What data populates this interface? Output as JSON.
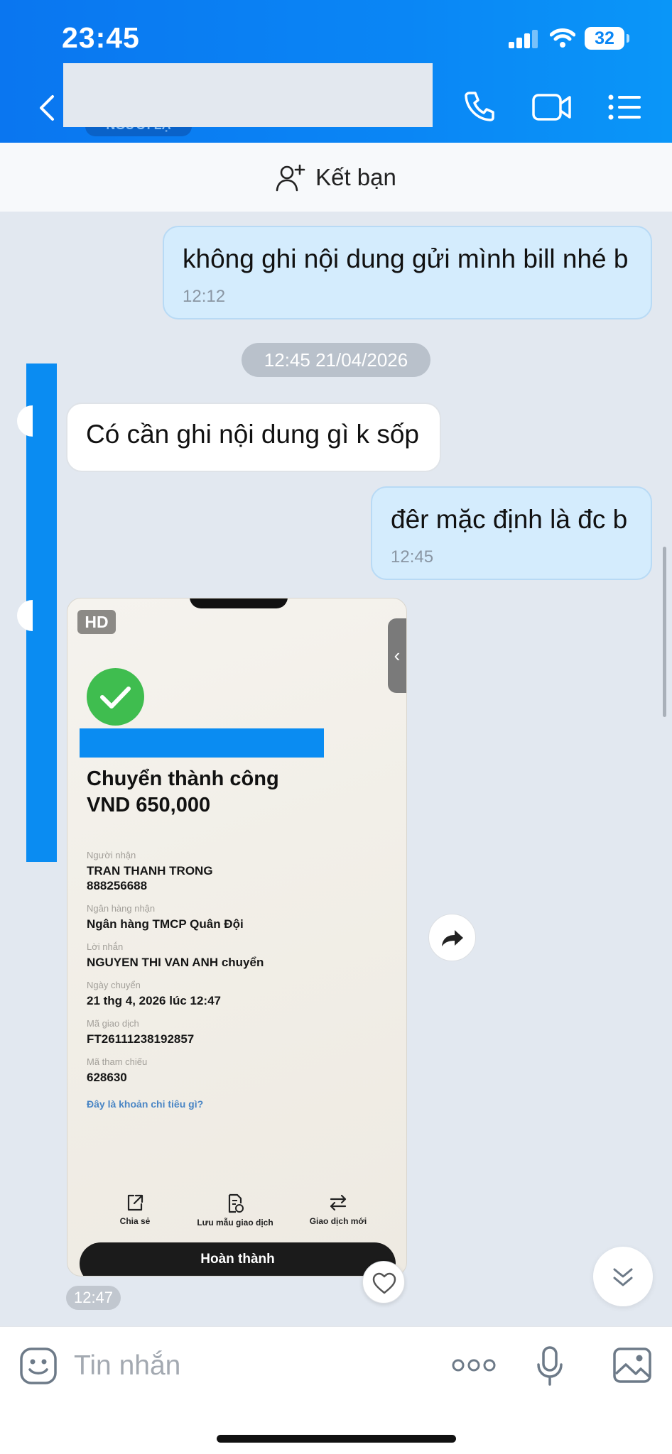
{
  "status_bar": {
    "time": "23:45",
    "battery": "32"
  },
  "header": {
    "name_tag": "NGƯỜI LẠ"
  },
  "friend_bar": {
    "label": "Kết bạn"
  },
  "messages": [
    {
      "side": "me",
      "text": "không ghi nội dung gửi mình bill nhé b",
      "time": "12:12"
    },
    {
      "side": "them",
      "text": "Có cần ghi nội dung gì k sốp"
    },
    {
      "side": "me",
      "text": "đêr mặc định là đc b",
      "time": "12:45"
    }
  ],
  "date_separator": "12:45 21/04/2026",
  "image_message": {
    "hd_label": "HD",
    "time": "12:47",
    "receipt": {
      "title_line1": "Chuyển thành công",
      "title_line2": "VND 650,000",
      "fields": [
        {
          "key": "Người nhận",
          "value": "TRAN THANH TRONG",
          "value2": "888256688"
        },
        {
          "key": "Ngân hàng nhận",
          "value": "Ngân hàng TMCP Quân Đội"
        },
        {
          "key": "Lời nhắn",
          "value": "NGUYEN THI VAN ANH chuyển"
        },
        {
          "key": "Ngày chuyển",
          "value": "21 thg 4, 2026 lúc 12:47"
        },
        {
          "key": "Mã giao dịch",
          "value": "FT26111238192857"
        },
        {
          "key": "Mã tham chiếu",
          "value": "628630"
        }
      ],
      "link": "Đây là khoản chi tiêu gì?",
      "actions": [
        "Chia sẻ",
        "Lưu mẫu giao dịch",
        "Giao dịch mới"
      ],
      "done_button": "Hoàn thành"
    }
  },
  "input": {
    "placeholder": "Tin nhắn"
  },
  "colors": {
    "header_blue": "#0a86f5",
    "my_bubble": "#d4ecfd",
    "success_green": "#3fbd4f"
  }
}
